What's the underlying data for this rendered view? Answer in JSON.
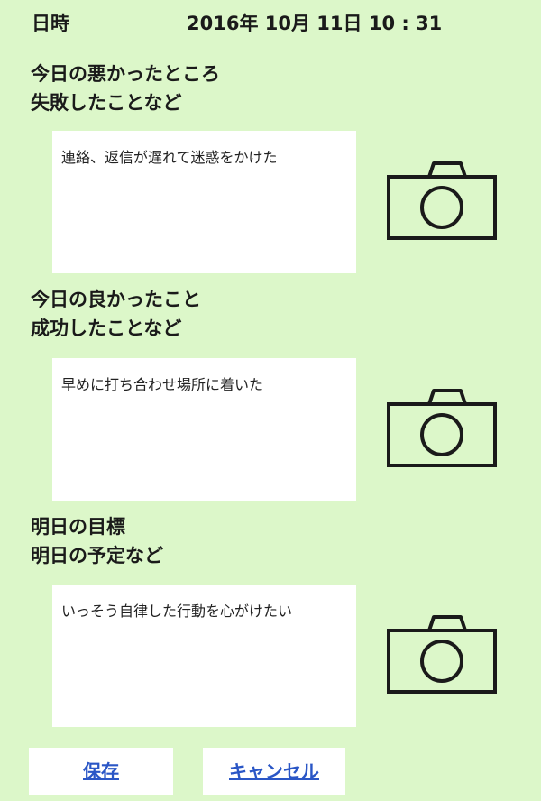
{
  "header": {
    "date_label": "日時",
    "date_value": "2016年 10月 11日 10 : 31"
  },
  "sections": [
    {
      "heading_line1": "今日の悪かったところ",
      "heading_line2": "失敗したことなど",
      "text": "連絡、返信が遅れて迷惑をかけた",
      "camera_icon": "camera-icon"
    },
    {
      "heading_line1": "今日の良かったこと",
      "heading_line2": "成功したことなど",
      "text": "早めに打ち合わせ場所に着いた",
      "camera_icon": "camera-icon"
    },
    {
      "heading_line1": "明日の目標",
      "heading_line2": "明日の予定など",
      "text": "いっそう自律した行動を心がけたい",
      "camera_icon": "camera-icon"
    }
  ],
  "buttons": {
    "save_label": "保存",
    "cancel_label": "キャンセル"
  },
  "colors": {
    "background": "#dcf7c9",
    "link": "#2a56c6",
    "box": "#ffffff"
  }
}
